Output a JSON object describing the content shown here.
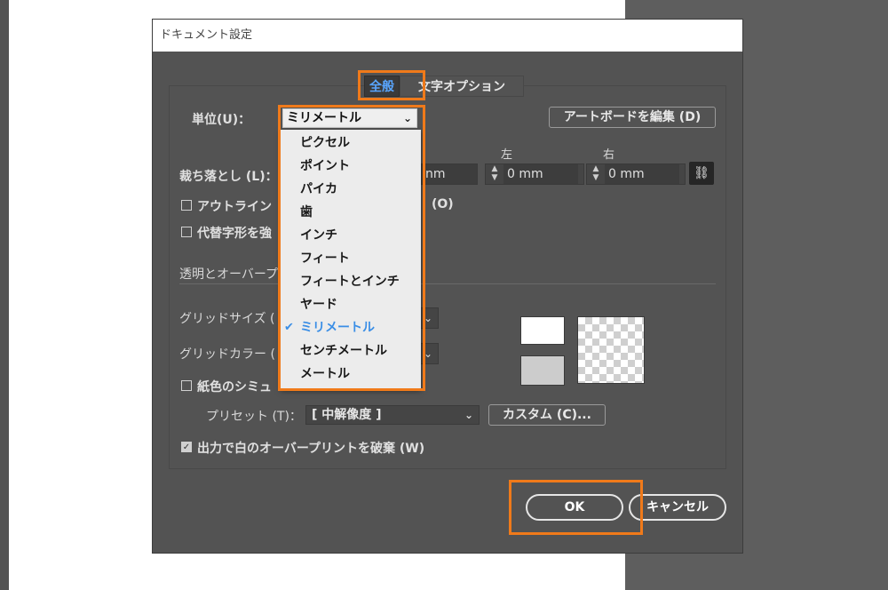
{
  "dialog": {
    "title": "ドキュメント設定",
    "tabs": [
      {
        "label": "全般",
        "active": true
      },
      {
        "label": "文字オプション",
        "active": false
      }
    ]
  },
  "units": {
    "label": "単位(U)：",
    "value": "ミリメートル",
    "options": [
      {
        "label": "ピクセル",
        "selected": false
      },
      {
        "label": "ポイント",
        "selected": false
      },
      {
        "label": "パイカ",
        "selected": false
      },
      {
        "label": "歯",
        "selected": false
      },
      {
        "label": "インチ",
        "selected": false
      },
      {
        "label": "フィート",
        "selected": false
      },
      {
        "label": "フィートとインチ",
        "selected": false
      },
      {
        "label": "ヤード",
        "selected": false
      },
      {
        "label": "ミリメートル",
        "selected": true
      },
      {
        "label": "センチメートル",
        "selected": false
      },
      {
        "label": "メートル",
        "selected": false
      }
    ]
  },
  "edit_artboard_label": "アートボードを編集 (D)",
  "bleed": {
    "label": "裁ち落とし (L)：",
    "left_label": "左",
    "right_label": "右",
    "bottom_value_partial": "nm",
    "left_value": "0 mm",
    "right_value": "0 mm"
  },
  "outline_checkbox": {
    "label_start": "アウトライン",
    "label_end": "(O)",
    "checked": false
  },
  "substitute_checkbox": {
    "label_start": "代替字形を強",
    "checked": false
  },
  "transparency": {
    "section_label": "透明とオーバープ",
    "grid_size_label": "グリッドサイズ (",
    "grid_color_label": "グリッドカラー (",
    "paper_sim_label": "紙色のシミュ",
    "preset_label": "プリセット (T)：",
    "preset_value": "[ 中解像度 ]",
    "custom_label": "カスタム (C)..."
  },
  "discard_overprint": {
    "label": "出力で白のオーバープリントを破棄 (W)",
    "checked": true
  },
  "buttons": {
    "ok": "OK",
    "cancel": "キャンセル"
  },
  "colors": {
    "highlight": "#f07a1a",
    "selected_text": "#3a8ee6"
  }
}
